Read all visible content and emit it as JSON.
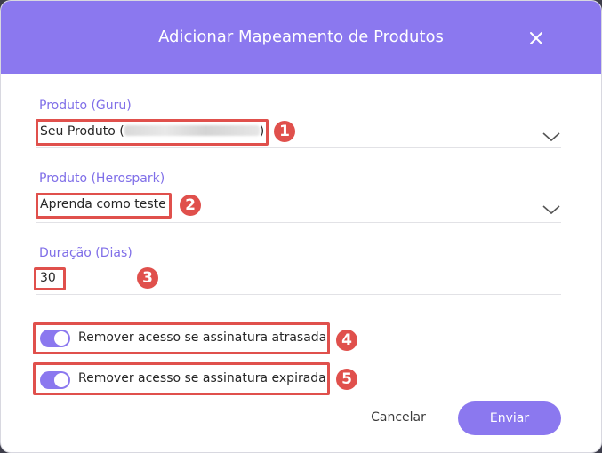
{
  "modal": {
    "title": "Adicionar Mapeamento de Produtos",
    "close_icon": "close-icon"
  },
  "fields": {
    "produto_guru": {
      "label": "Produto (Guru)",
      "value_prefix": "Seu Produto (",
      "value_suffix": ")",
      "badge": "1"
    },
    "produto_herospark": {
      "label": "Produto (Herospark)",
      "value": "Aprenda como teste",
      "badge": "2"
    },
    "duracao": {
      "label": "Duração (Dias)",
      "value": "30",
      "badge": "3"
    }
  },
  "toggles": [
    {
      "label": "Remover acesso se assinatura atrasada",
      "on": true,
      "badge": "4"
    },
    {
      "label": "Remover acesso se assinatura expirada",
      "on": true,
      "badge": "5"
    }
  ],
  "buttons": {
    "cancel": "Cancelar",
    "submit": "Enviar"
  },
  "colors": {
    "accent": "#8b78ef",
    "annotation": "#e0504c"
  }
}
